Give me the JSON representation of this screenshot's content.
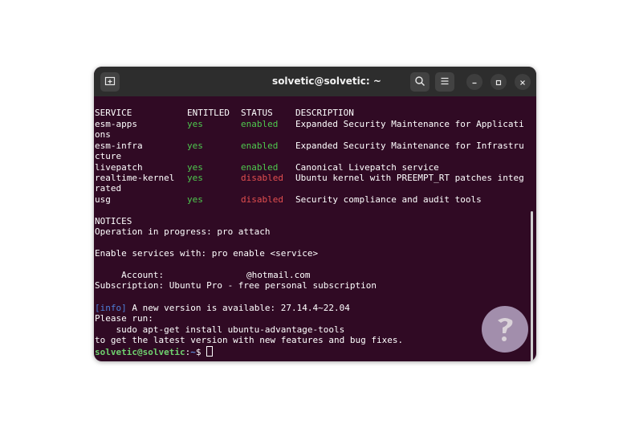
{
  "window": {
    "title": "solvetic@solvetic: ~",
    "icons": {
      "new_tab": "new-tab-icon",
      "search": "search-icon",
      "menu": "hamburger-menu-icon",
      "minimize": "minimize-icon",
      "maximize": "maximize-icon",
      "close": "close-icon"
    }
  },
  "colors": {
    "terminal_bg": "#300a24",
    "titlebar_bg": "#2d2d2d",
    "enabled": "#4ec94e",
    "disabled": "#e34f4f",
    "info": "#4d7fd8"
  },
  "terminal": {
    "headers": {
      "service": "SERVICE",
      "entitled": "ENTITLED",
      "status": "STATUS",
      "description": "DESCRIPTION"
    },
    "services": [
      {
        "name": "esm-apps",
        "entitled": "yes",
        "status": "enabled",
        "description": "Expanded Security Maintenance for Applicati",
        "wrap": "ons"
      },
      {
        "name": "esm-infra",
        "entitled": "yes",
        "status": "enabled",
        "description": "Expanded Security Maintenance for Infrastru",
        "wrap": "cture"
      },
      {
        "name": "livepatch",
        "entitled": "yes",
        "status": "enabled",
        "description": "Canonical Livepatch service",
        "wrap": ""
      },
      {
        "name": "realtime-kernel",
        "entitled": "yes",
        "status": "disabled",
        "description": "Ubuntu kernel with PREEMPT_RT patches integ",
        "wrap": "rated"
      },
      {
        "name": "usg",
        "entitled": "yes",
        "status": "disabled",
        "description": "Security compliance and audit tools",
        "wrap": ""
      }
    ],
    "notices_title": "NOTICES",
    "notice_1": "Operation in progress: pro attach",
    "enable_hint": "Enable services with: pro enable <service>",
    "account_label": "     Account:",
    "account_value": "@hotmail.com",
    "subscription": "Subscription: Ubuntu Pro - free personal subscription",
    "info_tag": "[info]",
    "info_text": " A new version is available: 27.14.4~22.04",
    "please_run": "Please run:",
    "command": "    sudo apt-get install ubuntu-advantage-tools",
    "get_latest": "to get the latest version with new features and bug fixes.",
    "prompt_user": "solvetic@solvetic",
    "prompt_sep": ":",
    "prompt_path": "~",
    "prompt_symbol": "$ "
  }
}
